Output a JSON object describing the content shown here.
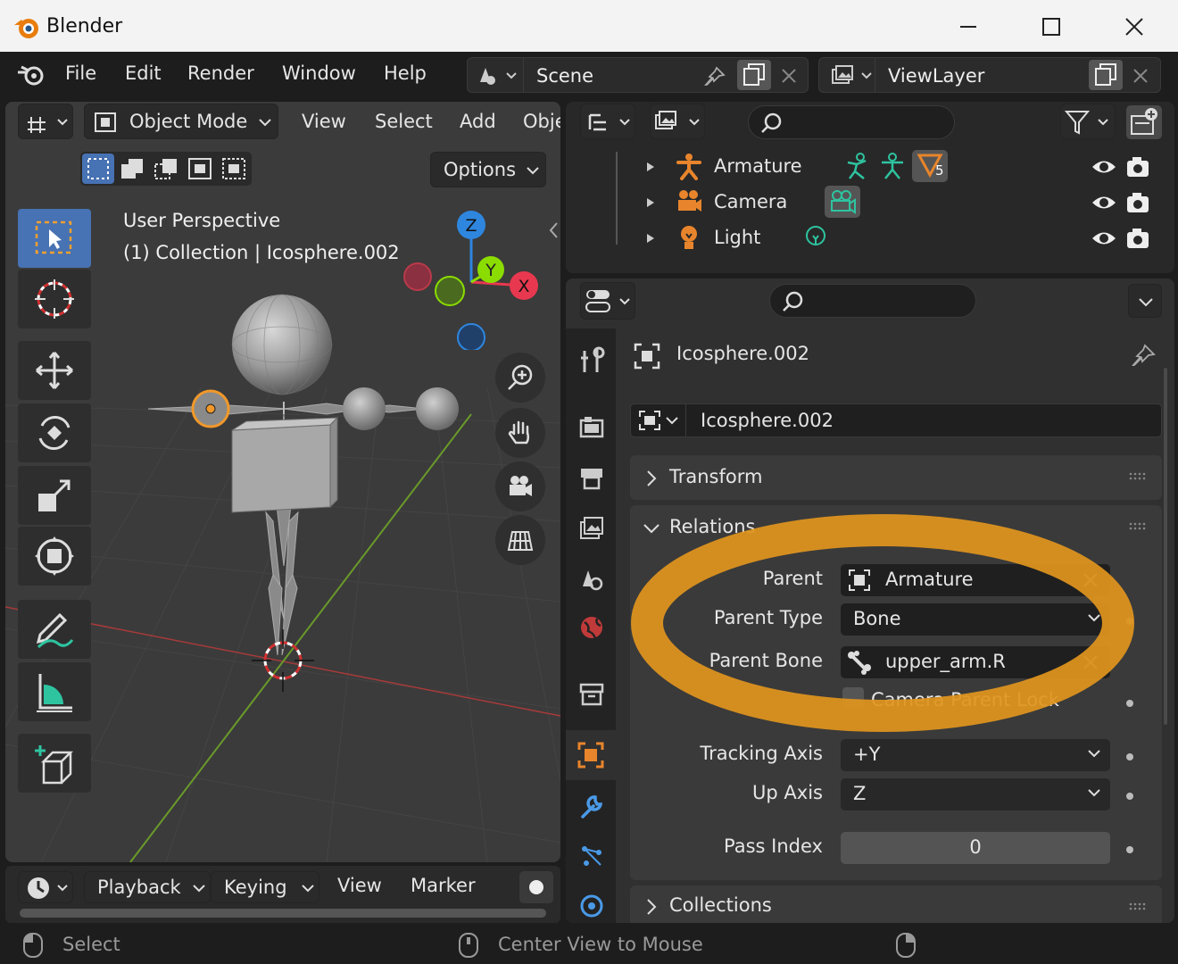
{
  "window": {
    "title": "Blender"
  },
  "topbar": {
    "menus": [
      "File",
      "Edit",
      "Render",
      "Window",
      "Help"
    ],
    "scene": "Scene",
    "view_layer": "ViewLayer"
  },
  "viewport": {
    "mode": "Object Mode",
    "menus": [
      "View",
      "Select",
      "Add",
      "Obje"
    ],
    "options_label": "Options",
    "overlay_line1": "User Perspective",
    "overlay_line2": "(1) Collection | Icosphere.002",
    "gizmo_axes": {
      "z": "Z",
      "y": "Y",
      "x": "X"
    }
  },
  "timeline": {
    "menus": [
      "Playback",
      "Keying",
      "View",
      "Marker"
    ]
  },
  "statusbar": {
    "left": "Select",
    "middle": "Center View to Mouse"
  },
  "outliner": {
    "items": [
      {
        "label": "Armature",
        "badge": "5"
      },
      {
        "label": "Camera"
      },
      {
        "label": "Light"
      }
    ]
  },
  "properties": {
    "object_name": "Icosphere.002",
    "datablock_name": "Icosphere.002",
    "panels": {
      "transform": "Transform",
      "relations": "Relations",
      "collections": "Collections"
    },
    "relations": {
      "parent_label": "Parent",
      "parent_value": "Armature",
      "parent_type_label": "Parent Type",
      "parent_type_value": "Bone",
      "parent_bone_label": "Parent Bone",
      "parent_bone_value": "upper_arm.R",
      "camera_lock_label": "Camera Parent Lock",
      "tracking_axis_label": "Tracking Axis",
      "tracking_axis_value": "+Y",
      "up_axis_label": "Up Axis",
      "up_axis_value": "Z",
      "pass_index_label": "Pass Index",
      "pass_index_value": "0"
    }
  },
  "colors": {
    "highlight_ring": "#e0951e",
    "active_blue": "#4772b3",
    "object_orange": "#e8852c",
    "x_axis": "#e8384f",
    "y_axis": "#8bdc00",
    "z_axis": "#2e86de"
  }
}
